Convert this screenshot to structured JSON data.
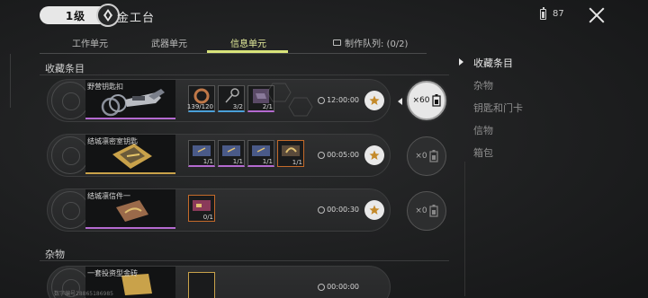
{
  "header": {
    "level": "1级",
    "title": "金工台",
    "battery": "87"
  },
  "tabs": [
    {
      "label": "工作单元"
    },
    {
      "label": "武器单元"
    },
    {
      "label": "信息单元"
    }
  ],
  "queue": {
    "label": "制作队列: (0/2)"
  },
  "sections": {
    "collectibles": "收藏条目",
    "misc": "杂物"
  },
  "rows": [
    {
      "name": "野营钥匙扣",
      "mats": [
        {
          "count": "139/120"
        },
        {
          "count": "3/2"
        },
        {
          "count": "2/1"
        }
      ],
      "time": "12:00:00",
      "qty": "×60"
    },
    {
      "name": "结城凛密室钥匙",
      "mats": [
        {
          "count": "1/1"
        },
        {
          "count": "1/1"
        },
        {
          "count": "1/1"
        },
        {
          "count": "1/1"
        }
      ],
      "time": "00:05:00",
      "qty": "×0"
    },
    {
      "name": "结城凛信件一",
      "mats": [
        {
          "count": "0/1"
        }
      ],
      "time": "00:00:30",
      "qty": "×0"
    },
    {
      "name": "一套投资型金砖",
      "time": "00:00:00"
    }
  ],
  "sidebar": [
    {
      "label": "收藏条目"
    },
    {
      "label": "杂物"
    },
    {
      "label": "钥匙和门卡"
    },
    {
      "label": "信物"
    },
    {
      "label": "箱包"
    }
  ],
  "footer": {
    "text": "数字编号28865186985"
  },
  "colors": {
    "accent": "#d9e47a",
    "purple": "#b46ad0",
    "gold": "#c9a24a"
  }
}
